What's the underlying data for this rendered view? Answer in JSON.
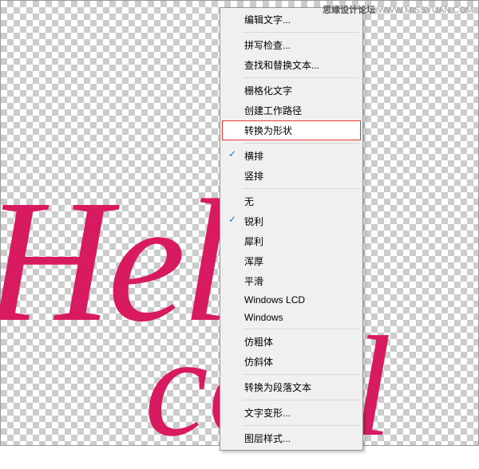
{
  "watermark": {
    "label": "思缘设计论坛",
    "url": "WWW.MISSYUAN.COM"
  },
  "canvas": {
    "text1": "Hello",
    "text2": "cool"
  },
  "menu": {
    "items": [
      {
        "label": "编辑文字...",
        "type": "item"
      },
      {
        "type": "separator"
      },
      {
        "label": "拼写检查...",
        "type": "item"
      },
      {
        "label": "查找和替换文本...",
        "type": "item"
      },
      {
        "type": "separator"
      },
      {
        "label": "栅格化文字",
        "type": "item"
      },
      {
        "label": "创建工作路径",
        "type": "item"
      },
      {
        "label": "转换为形状",
        "type": "item",
        "highlighted": true
      },
      {
        "type": "separator"
      },
      {
        "label": "横排",
        "type": "item",
        "checked": true
      },
      {
        "label": "竖排",
        "type": "item"
      },
      {
        "type": "separator"
      },
      {
        "label": "无",
        "type": "item"
      },
      {
        "label": "锐利",
        "type": "item",
        "checked": true
      },
      {
        "label": "犀利",
        "type": "item"
      },
      {
        "label": "浑厚",
        "type": "item"
      },
      {
        "label": "平滑",
        "type": "item"
      },
      {
        "label": "Windows LCD",
        "type": "item"
      },
      {
        "label": "Windows",
        "type": "item"
      },
      {
        "type": "separator"
      },
      {
        "label": "仿粗体",
        "type": "item"
      },
      {
        "label": "仿斜体",
        "type": "item"
      },
      {
        "type": "separator"
      },
      {
        "label": "转换为段落文本",
        "type": "item"
      },
      {
        "type": "separator"
      },
      {
        "label": "文字变形...",
        "type": "item"
      },
      {
        "type": "separator"
      },
      {
        "label": "图层样式...",
        "type": "item"
      }
    ]
  }
}
